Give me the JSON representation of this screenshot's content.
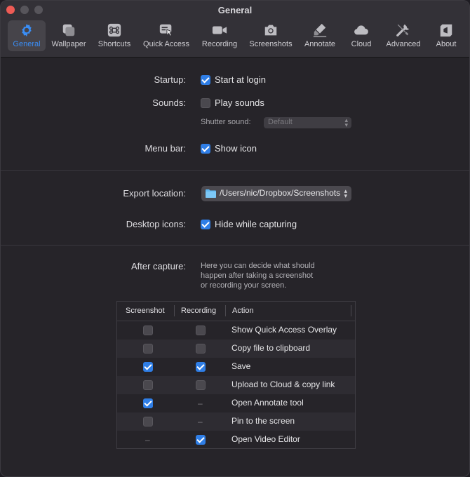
{
  "window": {
    "title": "General"
  },
  "toolbar": {
    "items": [
      {
        "label": "General",
        "icon": "gear-icon",
        "active": true
      },
      {
        "label": "Wallpaper",
        "icon": "wallpaper-icon"
      },
      {
        "label": "Shortcuts",
        "icon": "command-key-icon"
      },
      {
        "label": "Quick Access",
        "icon": "quick-access-icon"
      },
      {
        "label": "Recording",
        "icon": "video-camera-icon"
      },
      {
        "label": "Screenshots",
        "icon": "camera-icon"
      },
      {
        "label": "Annotate",
        "icon": "marker-icon"
      },
      {
        "label": "Cloud",
        "icon": "cloud-icon"
      },
      {
        "label": "Advanced",
        "icon": "tools-icon"
      },
      {
        "label": "About",
        "icon": "about-icon"
      }
    ],
    "accent": "#3a8ef6"
  },
  "general": {
    "startup_label": "Startup:",
    "start_at_login": {
      "label": "Start at login",
      "checked": true
    },
    "sounds_label": "Sounds:",
    "play_sounds": {
      "label": "Play sounds",
      "checked": false
    },
    "shutter_sound_label": "Shutter sound:",
    "shutter_sound_value": "Default",
    "menu_bar_label": "Menu bar:",
    "show_icon": {
      "label": "Show icon",
      "checked": true
    },
    "export_location_label": "Export location:",
    "export_location_value": "/Users/nic/Dropbox/Screenshots",
    "desktop_icons_label": "Desktop icons:",
    "hide_while_capturing": {
      "label": "Hide while capturing",
      "checked": true
    },
    "after_capture_label": "After capture:",
    "after_capture_desc_1": "Here you can decide what should",
    "after_capture_desc_2": "happen after taking a screenshot",
    "after_capture_desc_3": "or recording your screen."
  },
  "table": {
    "columns": [
      "Screenshot",
      "Recording",
      "Action"
    ],
    "rows": [
      {
        "screenshot": "off",
        "recording": "off",
        "action": "Show Quick Access Overlay"
      },
      {
        "screenshot": "off",
        "recording": "off",
        "action": "Copy file to clipboard"
      },
      {
        "screenshot": "on",
        "recording": "on",
        "action": "Save"
      },
      {
        "screenshot": "off",
        "recording": "off",
        "action": "Upload to Cloud & copy link"
      },
      {
        "screenshot": "on",
        "recording": "none",
        "action": "Open Annotate tool"
      },
      {
        "screenshot": "off",
        "recording": "none",
        "action": "Pin to the screen"
      },
      {
        "screenshot": "none",
        "recording": "on",
        "action": "Open Video Editor"
      }
    ],
    "dash": "–"
  }
}
